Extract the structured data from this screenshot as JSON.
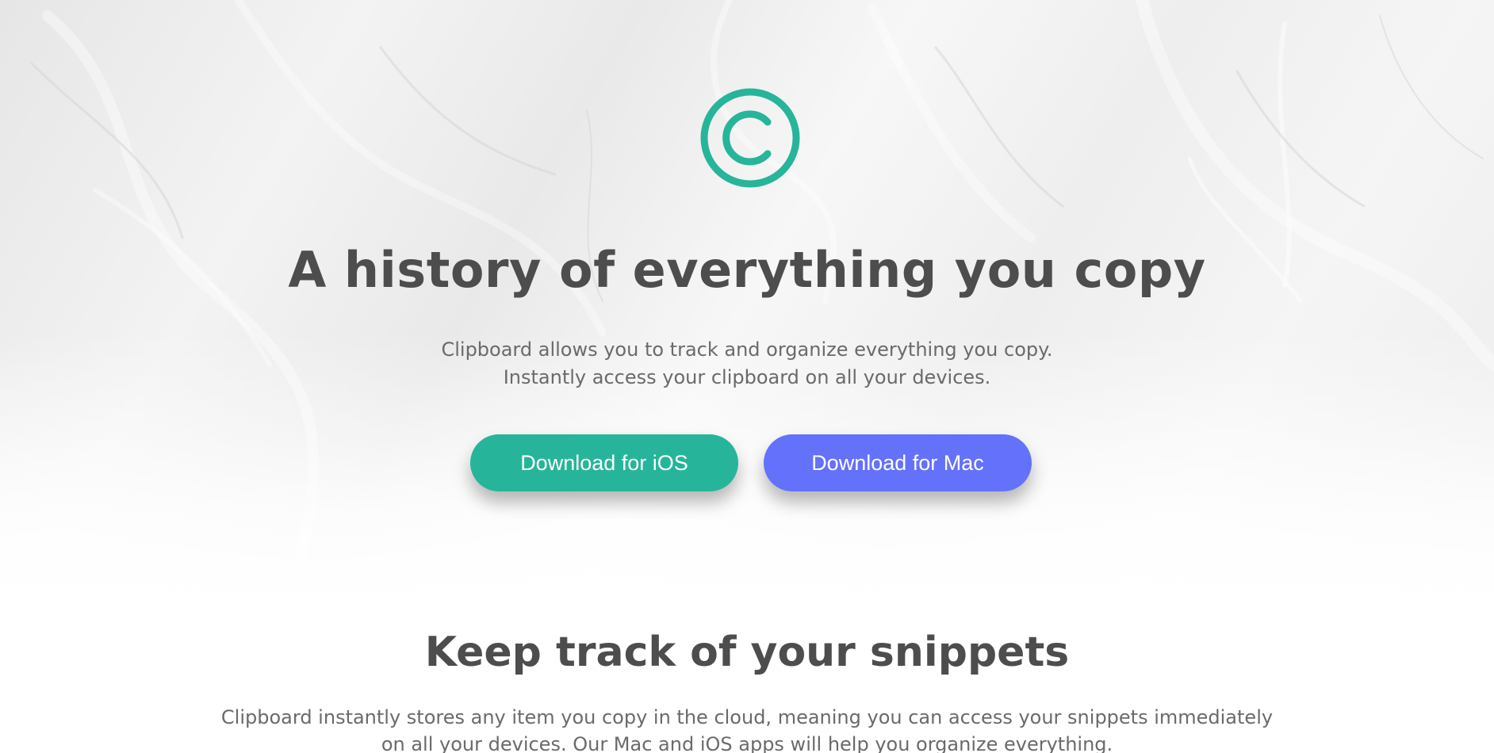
{
  "hero": {
    "logo_icon": "copyright-c-logo-icon",
    "accent_color": "#26b59a",
    "title": "A history of everything you copy",
    "subtitle_line1": "Clipboard allows you to track and organize everything you copy.",
    "subtitle_line2": "Instantly access your clipboard on all your devices.",
    "buttons": {
      "ios": {
        "label": "Download for iOS",
        "color": "#26b59a"
      },
      "mac": {
        "label": "Download for Mac",
        "color": "#6471fb"
      }
    }
  },
  "features": {
    "title": "Keep track of your snippets",
    "text_line1": "Clipboard instantly stores any item you copy in the cloud, meaning you can access your snippets immediately",
    "text_line2": "on all your devices. Our Mac and iOS apps will help you organize everything."
  }
}
